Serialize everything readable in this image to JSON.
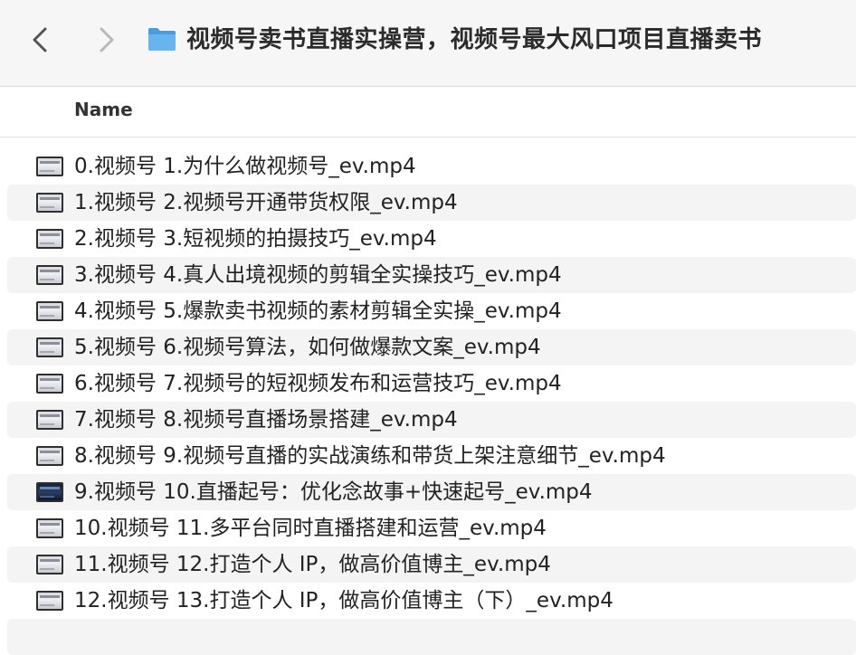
{
  "window": {
    "title": "视频号卖书直播实操营，视频号最大风口项目直播卖书",
    "folder_icon": "folder-icon",
    "accent": "#5aa9e6"
  },
  "header": {
    "name_label": "Name"
  },
  "files": [
    {
      "name": "0.视频号 1.为什么做视频号_ev.mp4",
      "icon": "video-file-icon"
    },
    {
      "name": "1.视频号 2.视频号开通带货权限_ev.mp4",
      "icon": "video-file-icon"
    },
    {
      "name": "2.视频号 3.短视频的拍摄技巧_ev.mp4",
      "icon": "video-file-icon"
    },
    {
      "name": "3.视频号 4.真人出境视频的剪辑全实操技巧_ev.mp4",
      "icon": "video-file-icon"
    },
    {
      "name": "4.视频号 5.爆款卖书视频的素材剪辑全实操_ev.mp4",
      "icon": "video-file-icon"
    },
    {
      "name": "5.视频号 6.视频号算法，如何做爆款文案_ev.mp4",
      "icon": "video-file-icon"
    },
    {
      "name": "6.视频号 7.视频号的短视频发布和运营技巧_ev.mp4",
      "icon": "video-file-icon"
    },
    {
      "name": "7.视频号 8.视频号直播场景搭建_ev.mp4",
      "icon": "video-file-icon"
    },
    {
      "name": "8.视频号 9.视频号直播的实战演练和带货上架注意细节_ev.mp4",
      "icon": "video-file-icon"
    },
    {
      "name": "9.视频号 10.直播起号：优化念故事+快速起号_ev.mp4",
      "icon": "video-file-icon-dark"
    },
    {
      "name": "10.视频号 11.多平台同时直播搭建和运营_ev.mp4",
      "icon": "video-file-icon"
    },
    {
      "name": "11.视频号 12.打造个人 IP，做高价值博主_ev.mp4",
      "icon": "video-file-icon"
    },
    {
      "name": "12.视频号 13.打造个人 IP，做高价值博主（下）_ev.mp4",
      "icon": "video-file-icon"
    }
  ]
}
